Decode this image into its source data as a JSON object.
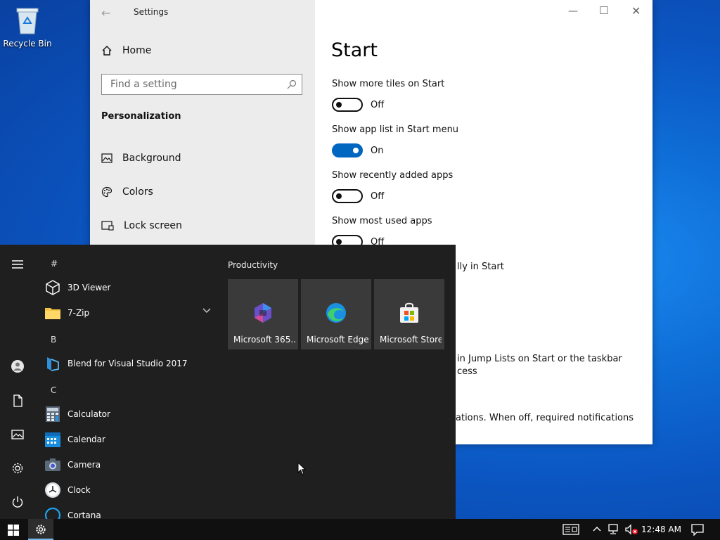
{
  "desktop": {
    "recycle_bin_label": "Recycle Bin"
  },
  "settings": {
    "title": "Settings",
    "home_label": "Home",
    "search_placeholder": "Find a setting",
    "section_heading": "Personalization",
    "nav_items": [
      {
        "label": "Background",
        "icon": "picture-icon"
      },
      {
        "label": "Colors",
        "icon": "palette-icon"
      },
      {
        "label": "Lock screen",
        "icon": "lock-screen-icon"
      }
    ],
    "page_title": "Start",
    "options": [
      {
        "label": "Show more tiles on Start",
        "state": "Off"
      },
      {
        "label": "Show app list in Start menu",
        "state": "On"
      },
      {
        "label": "Show recently added apps",
        "state": "Off"
      },
      {
        "label": "Show most used apps",
        "state": "Off"
      }
    ],
    "partial_text": [
      "lly in Start",
      "in Jump Lists on Start or the taskbar",
      "cess",
      "ations. When off, required notifications"
    ]
  },
  "start_menu": {
    "letters": [
      "#",
      "B",
      "C"
    ],
    "apps": [
      {
        "label": "3D Viewer",
        "icon": "cube-icon"
      },
      {
        "label": "7-Zip",
        "icon": "folder-icon"
      },
      {
        "label": "Blend for Visual Studio 2017",
        "icon": "blend-icon"
      },
      {
        "label": "Calculator",
        "icon": "calculator-icon"
      },
      {
        "label": "Calendar",
        "icon": "calendar-icon"
      },
      {
        "label": "Camera",
        "icon": "camera-icon"
      },
      {
        "label": "Clock",
        "icon": "clock-icon"
      },
      {
        "label": "Cortana",
        "icon": "cortana-icon"
      }
    ],
    "group_title": "Productivity",
    "tiles": [
      {
        "label": "Microsoft 365...",
        "icon": "microsoft-365-icon"
      },
      {
        "label": "Microsoft Edge",
        "icon": "edge-icon"
      },
      {
        "label": "Microsoft Store",
        "icon": "store-icon"
      }
    ]
  },
  "taskbar": {
    "time": "12:48 AM"
  },
  "colors": {
    "accent": "#0067c0",
    "start_bg": "#1f1f1f",
    "tile_bg": "#3a3a3a"
  }
}
